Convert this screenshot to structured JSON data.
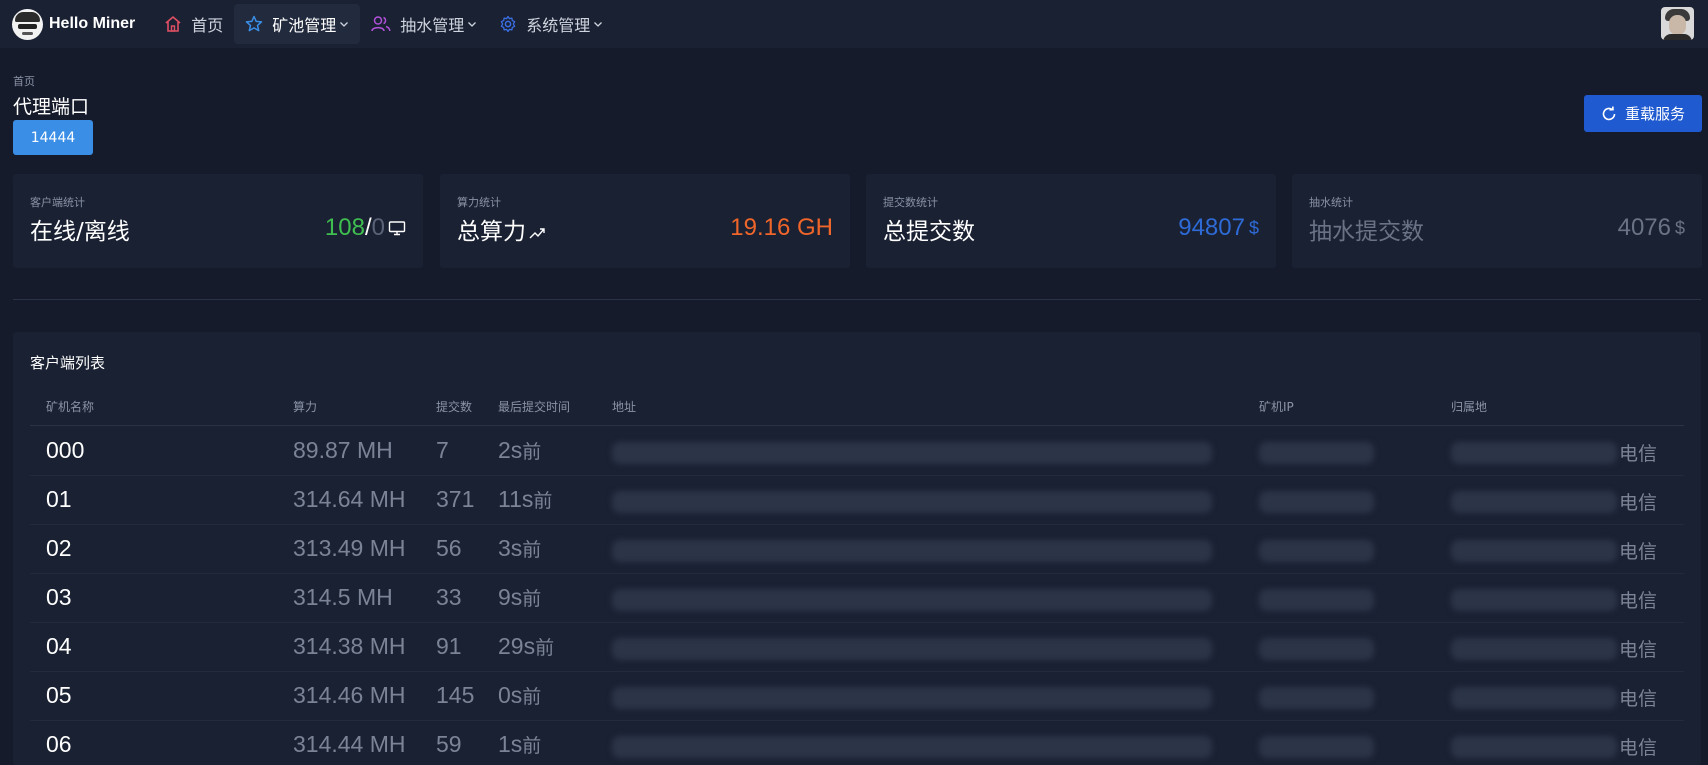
{
  "brand": {
    "name": "Hello Miner"
  },
  "nav": [
    {
      "label": "首页",
      "icon": "home-icon",
      "color": "#e05064"
    },
    {
      "label": "矿池管理",
      "icon": "star-icon",
      "color": "#3a8ee6",
      "active": true
    },
    {
      "label": "抽水管理",
      "icon": "users-icon",
      "color": "#b152d9"
    },
    {
      "label": "系统管理",
      "icon": "gear-icon",
      "color": "#3a6fe6"
    }
  ],
  "breadcrumb": "首页",
  "page_title": "代理端口",
  "port": "14444",
  "reload_label": "重载服务",
  "cards": [
    {
      "caption": "客户端统计",
      "label": "在线/离线",
      "online": "108",
      "sep": "/",
      "offline": "0",
      "icon": "monitor-icon"
    },
    {
      "caption": "算力统计",
      "label": "总算力",
      "value": "19.16 GH",
      "icon": "trend-up-icon",
      "color": "#f0662a"
    },
    {
      "caption": "提交数统计",
      "label": "总提交数",
      "value": "94807",
      "unit": "$",
      "color": "#2e6bd6"
    },
    {
      "caption": "抽水统计",
      "label": "抽水提交数",
      "value": "4076",
      "unit": "$",
      "color": "#6a7385"
    }
  ],
  "table": {
    "title": "客户端列表",
    "headers": [
      "矿机名称",
      "算力",
      "提交数",
      "最后提交时间",
      "地址",
      "矿机IP",
      "归属地"
    ],
    "rows": [
      {
        "name": "000",
        "hash": "89.87 MH",
        "shares": "7",
        "last": "2s",
        "last_sfx": "前",
        "carrier": "电信"
      },
      {
        "name": "01",
        "hash": "314.64 MH",
        "shares": "371",
        "last": "11s",
        "last_sfx": "前",
        "carrier": "电信"
      },
      {
        "name": "02",
        "hash": "313.49 MH",
        "shares": "56",
        "last": "3s",
        "last_sfx": "前",
        "carrier": "电信"
      },
      {
        "name": "03",
        "hash": "314.5 MH",
        "shares": "33",
        "last": "9s",
        "last_sfx": "前",
        "carrier": "电信"
      },
      {
        "name": "04",
        "hash": "314.38 MH",
        "shares": "91",
        "last": "29s",
        "last_sfx": "前",
        "carrier": "电信"
      },
      {
        "name": "05",
        "hash": "314.46 MH",
        "shares": "145",
        "last": "0s",
        "last_sfx": "前",
        "carrier": "电信"
      },
      {
        "name": "06",
        "hash": "314.44 MH",
        "shares": "59",
        "last": "1s",
        "last_sfx": "前",
        "carrier": "电信"
      }
    ]
  }
}
